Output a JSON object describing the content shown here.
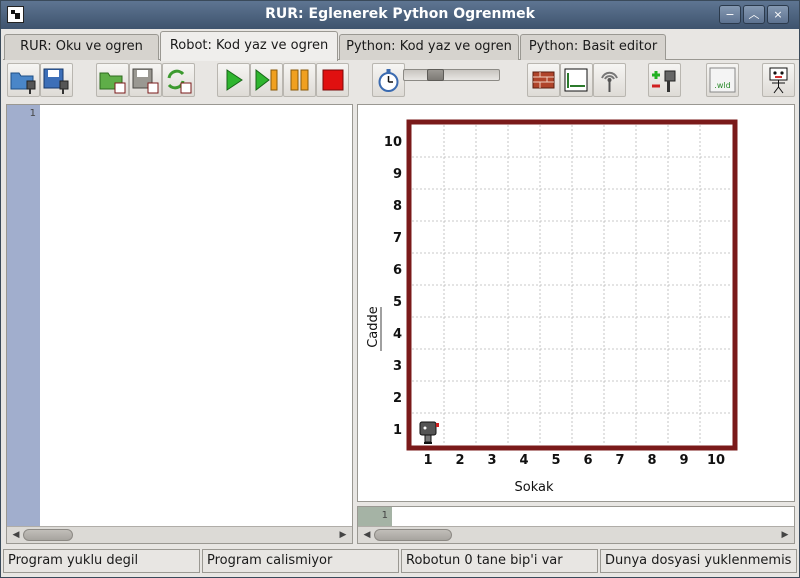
{
  "window": {
    "title": "RUR: Eglenerek Python Ogrenmek",
    "controls": [
      "−",
      "︿",
      "×"
    ]
  },
  "tabs": [
    {
      "label": "RUR: Oku ve ogren",
      "active": false
    },
    {
      "label": "Robot: Kod yaz ve ogren",
      "active": true
    },
    {
      "label": "Python: Kod yaz ve ogren",
      "active": false
    },
    {
      "label": "Python: Basit editor",
      "active": false
    }
  ],
  "toolbar": {
    "buttons": [
      {
        "name": "open-program-button",
        "icon": "folder-robot-icon"
      },
      {
        "name": "save-program-button",
        "icon": "floppy-robot-icon"
      },
      {
        "name": "open-world-button",
        "icon": "folder-world-icon"
      },
      {
        "name": "save-world-button",
        "icon": "floppy-world-icon"
      },
      {
        "name": "reload-world-button",
        "icon": "refresh-world-icon"
      },
      {
        "name": "run-button",
        "icon": "play-icon"
      },
      {
        "name": "step-button",
        "icon": "step-icon"
      },
      {
        "name": "pause-button",
        "icon": "pause-icon"
      },
      {
        "name": "stop-button",
        "icon": "stop-icon"
      },
      {
        "name": "speed-timer-button",
        "icon": "stopwatch-icon"
      },
      {
        "name": "edit-walls-button",
        "icon": "brick-wall-icon"
      },
      {
        "name": "resize-world-button",
        "icon": "resize-world-icon"
      },
      {
        "name": "beeper-button",
        "icon": "antenna-icon"
      },
      {
        "name": "add-robot-button",
        "icon": "add-robot-icon"
      },
      {
        "name": "world-file-button",
        "icon": "wld-file-icon"
      },
      {
        "name": "robot-face-button",
        "icon": "robot-face-icon"
      }
    ],
    "speed_slider_value": 0.3
  },
  "editor": {
    "line_numbers": [
      "1"
    ],
    "content": ""
  },
  "world": {
    "avenues_label": "Sokak",
    "streets_label": "Cadde",
    "x_ticks": [
      "1",
      "2",
      "3",
      "4",
      "5",
      "6",
      "7",
      "8",
      "9",
      "10"
    ],
    "y_ticks": [
      "1",
      "2",
      "3",
      "4",
      "5",
      "6",
      "7",
      "8",
      "9",
      "10"
    ],
    "robot": {
      "avenue": 1,
      "street": 1,
      "facing": "east"
    },
    "wall_color": "#7a1a1a",
    "grid_color": "#b8b8b8"
  },
  "output": {
    "line_numbers": [
      "1"
    ],
    "content": ""
  },
  "status": [
    "Program yuklu degil",
    "Program calismiyor",
    "Robotun 0 tane bip'i var",
    "Dunya dosyasi yuklenmemis"
  ]
}
